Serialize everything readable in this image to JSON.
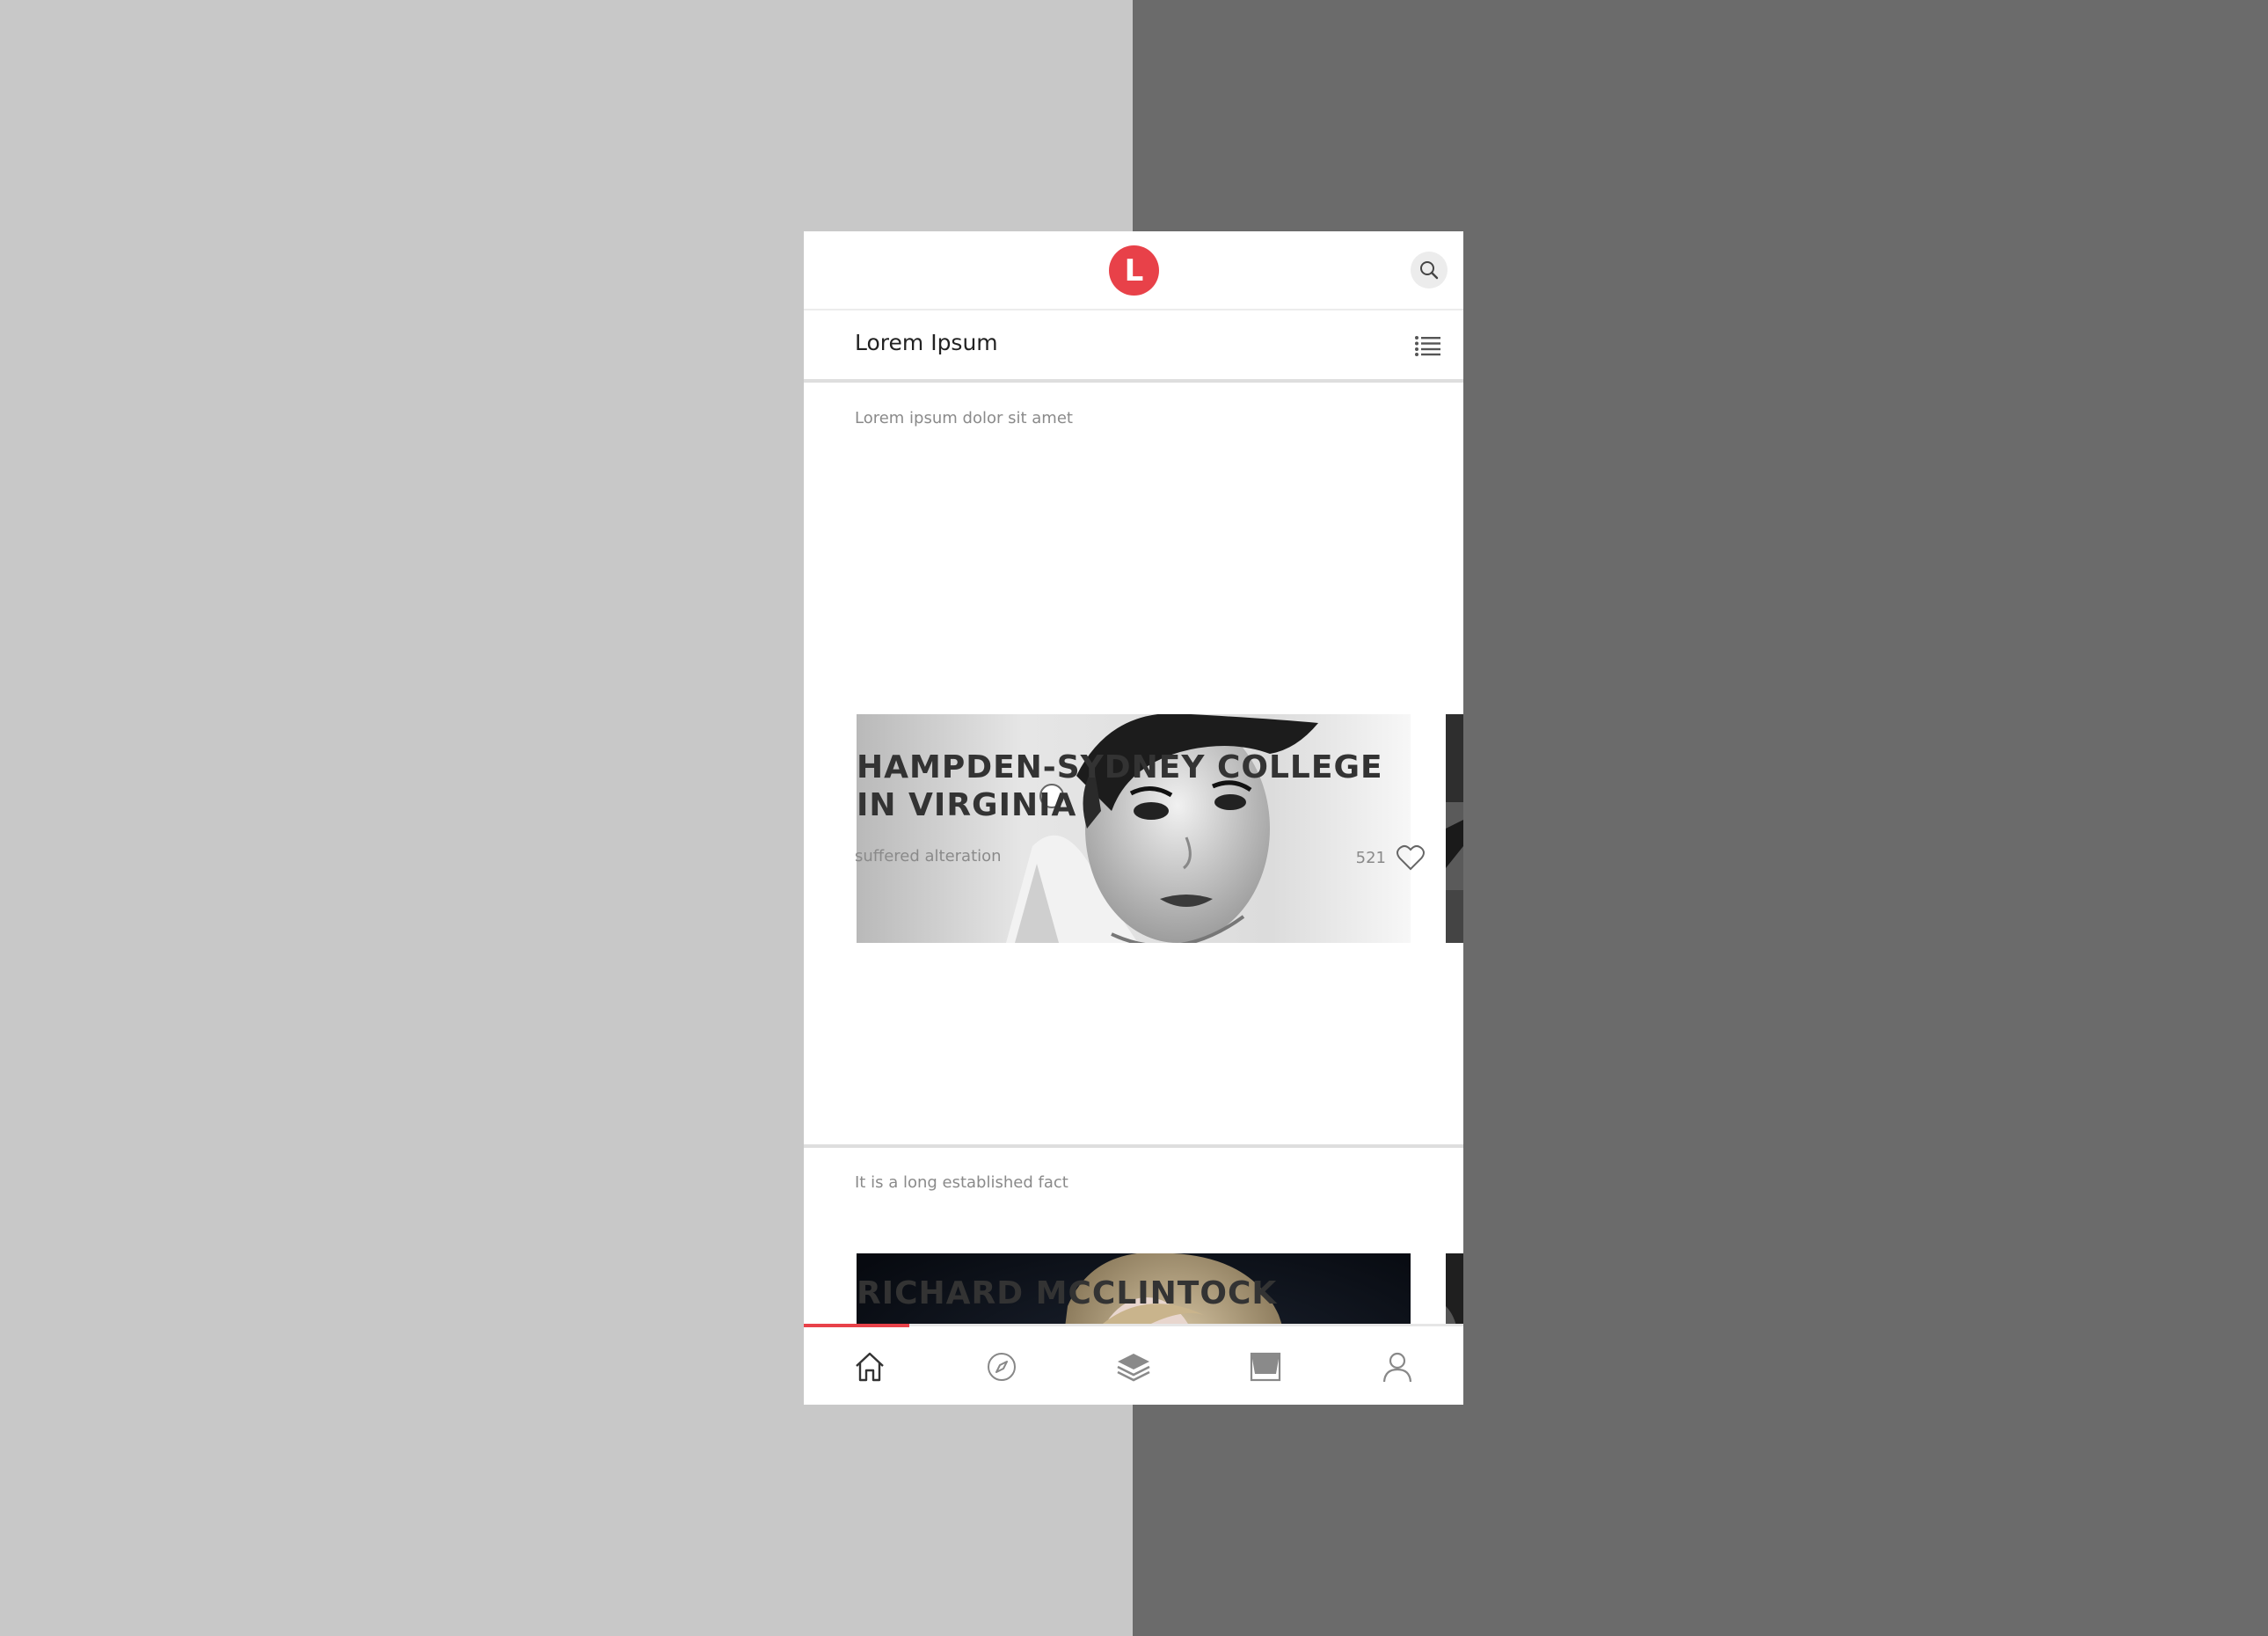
{
  "app": {
    "logo_letter": "L",
    "accent_color": "#e84149"
  },
  "header": {
    "logo_icon": "brand-logo-icon",
    "search_icon": "search-icon"
  },
  "section": {
    "title": "Lorem Ipsum",
    "menu_icon": "list-icon"
  },
  "feed": [
    {
      "label": "Lorem ipsum dolor sit amet",
      "title": "HAMPDEN-SYDNEY COLLEGE IN VIRGINIA",
      "subtitle": "suffered alteration",
      "likes": "521"
    },
    {
      "label": "It is a long established fact",
      "title": "RICHARD MCCLINTOCK"
    }
  ],
  "tabbar": {
    "tabs": [
      {
        "icon": "home-icon",
        "active": true
      },
      {
        "icon": "compass-icon",
        "active": false
      },
      {
        "icon": "layers-icon",
        "active": false
      },
      {
        "icon": "inbox-icon",
        "active": false
      },
      {
        "icon": "user-icon",
        "active": false
      }
    ]
  }
}
